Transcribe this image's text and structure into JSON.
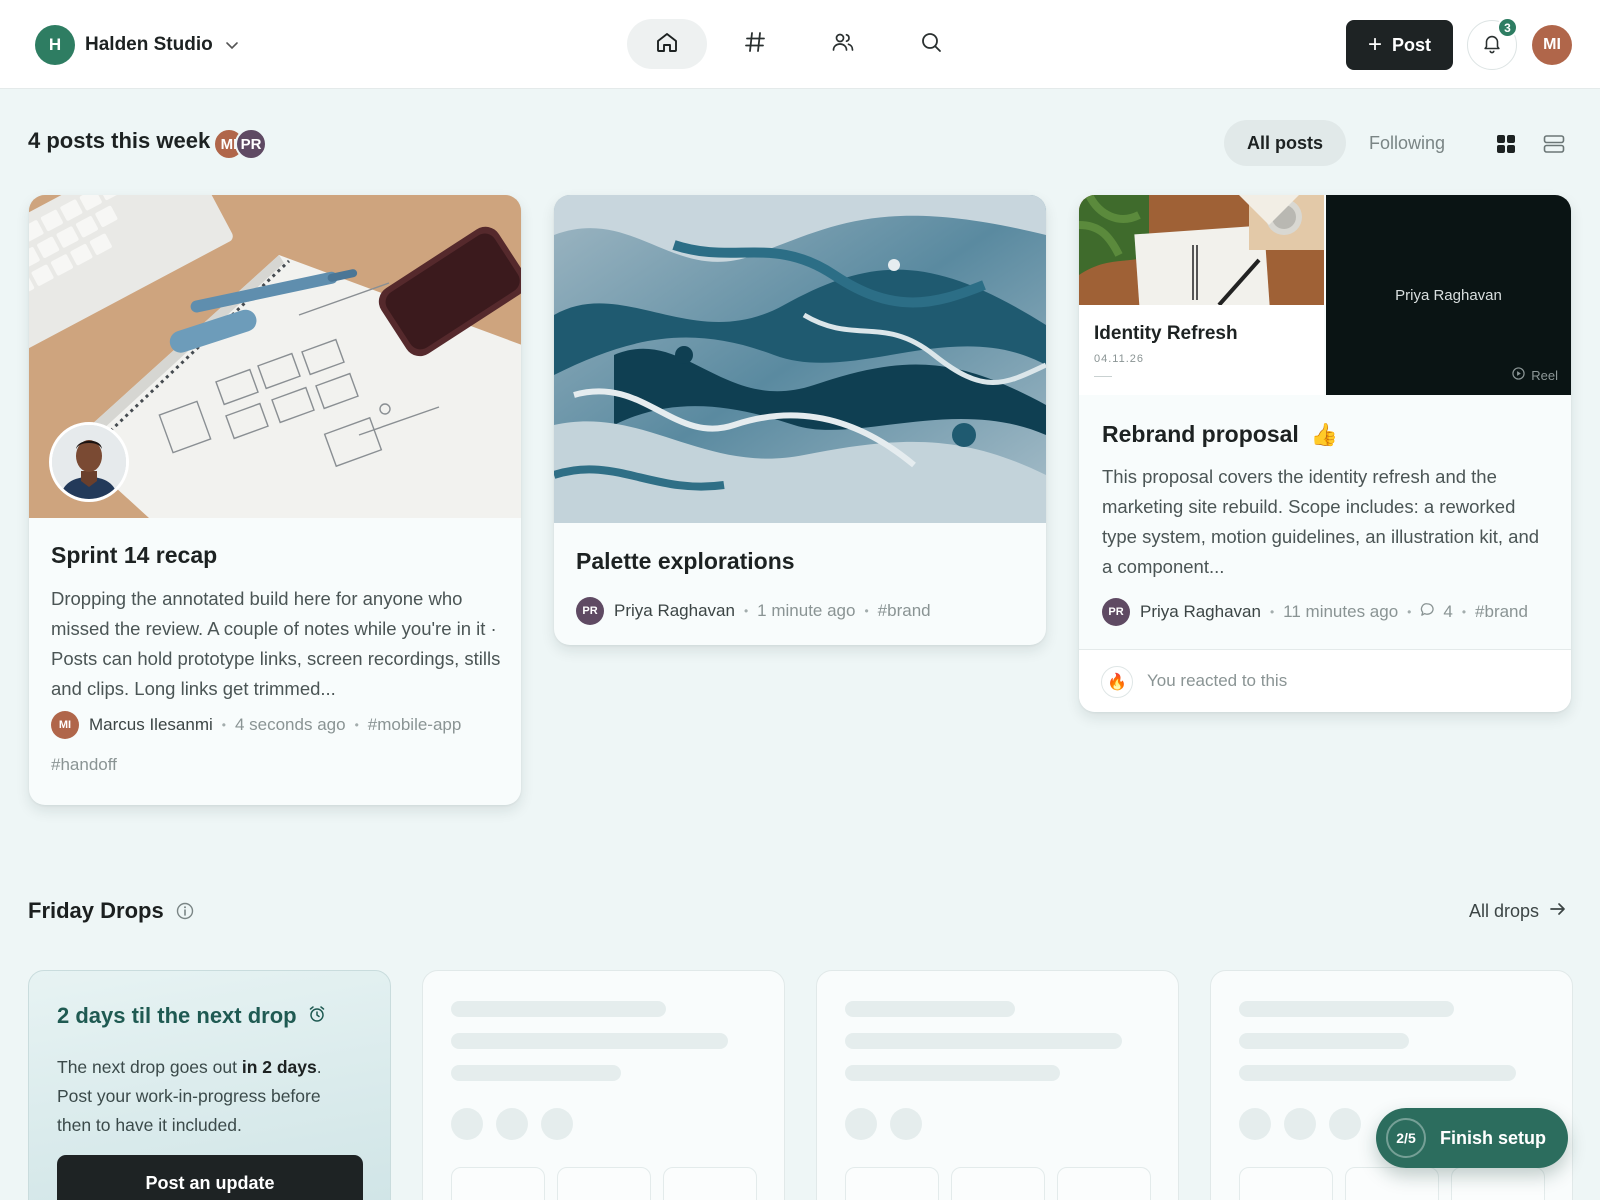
{
  "workspace": {
    "initial": "H",
    "name": "Halden Studio"
  },
  "nav": [
    "home-icon",
    "hashtag-icon",
    "people-icon",
    "search-icon"
  ],
  "header": {
    "post_label": "Post",
    "notification_count": "3",
    "user_initials": "MI"
  },
  "feed": {
    "title": "4 posts this week",
    "avatars": [
      "MI",
      "PR"
    ],
    "filters": [
      "All posts",
      "Following"
    ],
    "active_filter": "All posts"
  },
  "cards": [
    {
      "title": "Sprint 14 recap",
      "body": "Dropping the annotated build here for anyone who missed the review. A couple of notes while you're in it · Posts can hold prototype links, screen recordings, stills and clips. Long links get trimmed...",
      "author_initials": "MI",
      "author": "Marcus Ilesanmi",
      "time": "4 seconds ago",
      "tags": [
        "#mobile-app",
        "#handoff"
      ]
    },
    {
      "title": "Palette explorations",
      "author_initials": "PR",
      "author": "Priya Raghavan",
      "time": "1 minute ago",
      "tags": [
        "#brand"
      ]
    },
    {
      "doc_title": "Identity Refresh",
      "doc_date": "04.11.26",
      "reel_author": "Priya Raghavan",
      "reel_label": "Reel",
      "title": "Rebrand proposal",
      "emoji": "👍",
      "body": "This proposal covers the identity refresh and the marketing site rebuild. Scope includes: a reworked type system, motion guidelines, an illustration kit, and a component...",
      "author_initials": "PR",
      "author": "Priya Raghavan",
      "time": "11 minutes ago",
      "comments": "4",
      "tags": [
        "#brand"
      ],
      "reaction_emoji": "🔥",
      "reaction_text": "You reacted to this"
    }
  ],
  "drops": {
    "title": "Friday Drops",
    "all_label": "All drops",
    "info_title": "2 days til the next drop",
    "info_text_1": "The next drop goes out ",
    "info_text_bold": "in 2 days",
    "info_text_2": ". Post your work-in-progress before then to have it included.",
    "button": "Post an update"
  },
  "setup": {
    "step": "2/5",
    "label": "Finish setup"
  },
  "colors": {
    "brand": "#2e7d62",
    "dark": "#1e2324",
    "background": "#eef6f6"
  }
}
